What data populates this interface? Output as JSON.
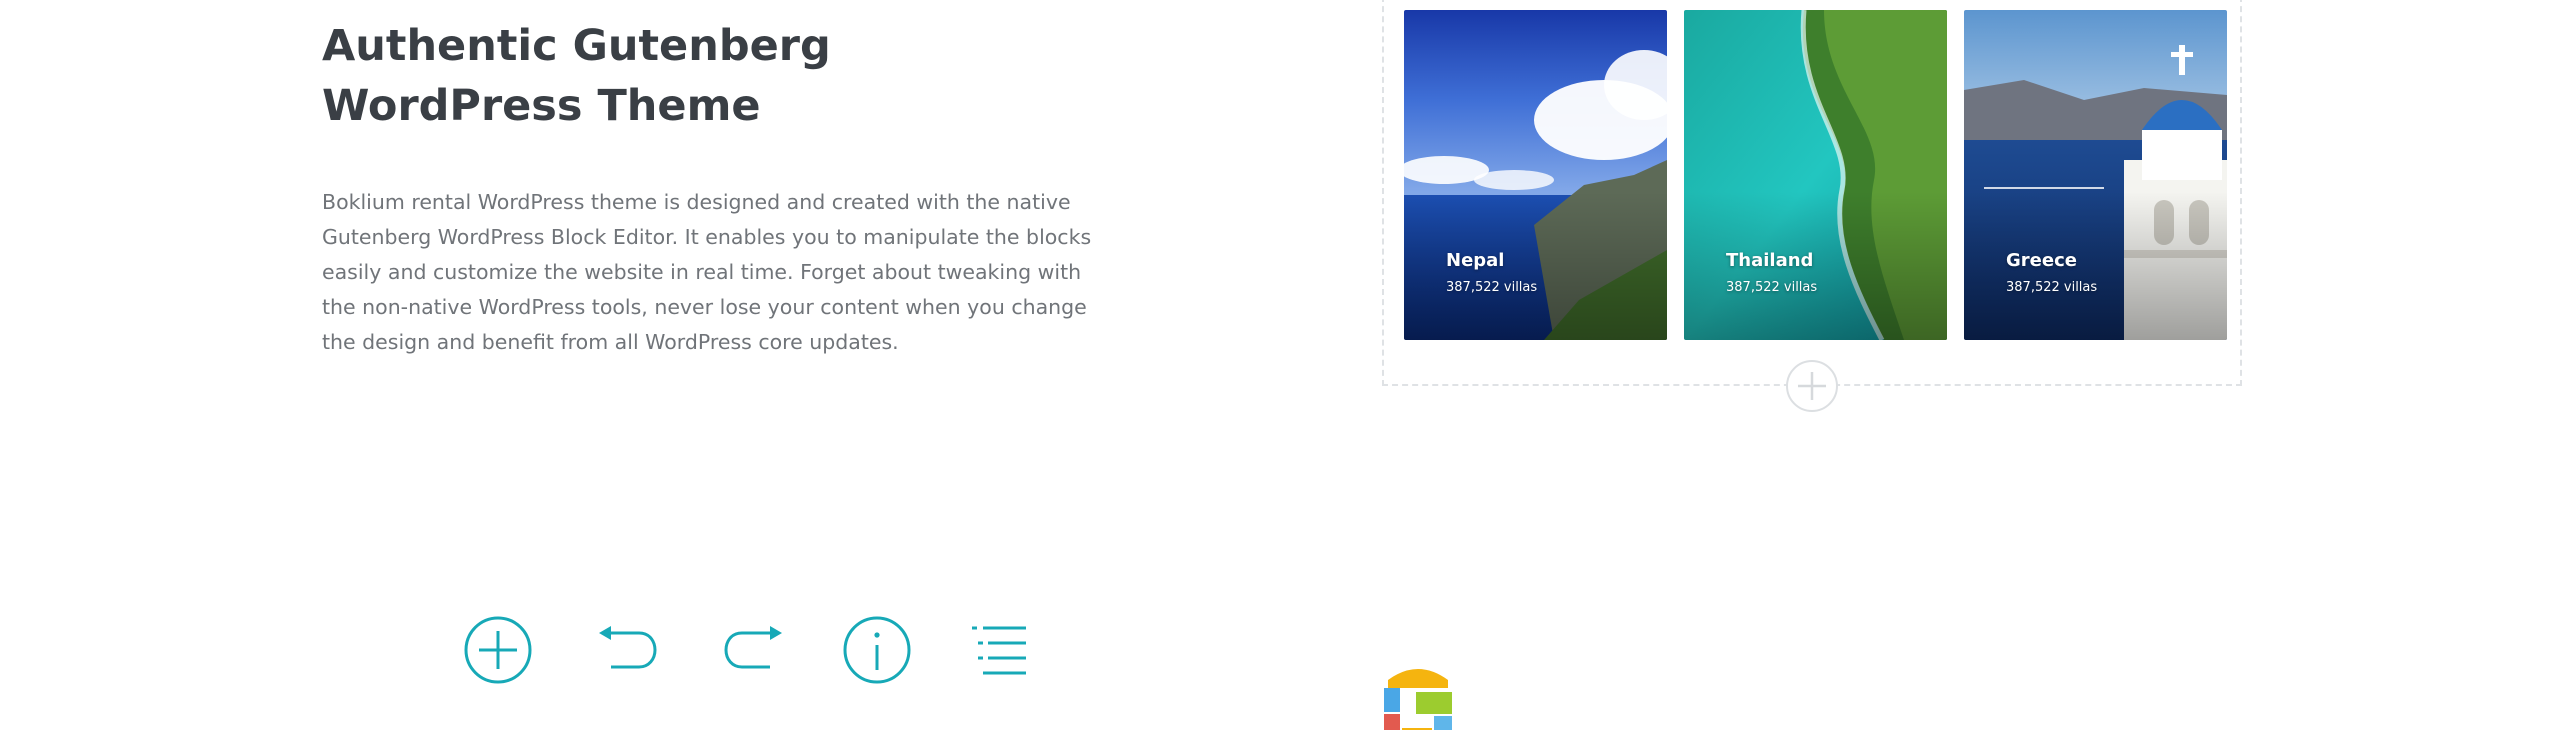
{
  "hero": {
    "title_line1": "Authentic Gutenberg",
    "title_line2": "WordPress Theme",
    "description": [
      "Boklium rental WordPress theme is designed and created with the native",
      "Gutenberg WordPress Block Editor. It enables you to manipulate the blocks",
      "easily and customize the website in real time. Forget about tweaking with",
      "the non-native WordPress tools, never lose your content when you change",
      "the design and benefit from all WordPress core updates."
    ]
  },
  "gallery": {
    "cards": [
      {
        "title": "Nepal",
        "subtitle": "387,522 villas"
      },
      {
        "title": "Thailand",
        "subtitle": "387,522 villas"
      },
      {
        "title": "Greece",
        "subtitle": "387,522 villas"
      }
    ],
    "add_block_icon": "plus-circle-icon"
  },
  "toolbar": {
    "icons": [
      "add-block-icon",
      "undo-icon",
      "redo-icon",
      "info-icon",
      "outline-icon"
    ]
  },
  "colors": {
    "accent": "#17a9b7",
    "heading": "#3a3f45",
    "body": "#707479",
    "dashed_border": "#dfe2e5"
  }
}
